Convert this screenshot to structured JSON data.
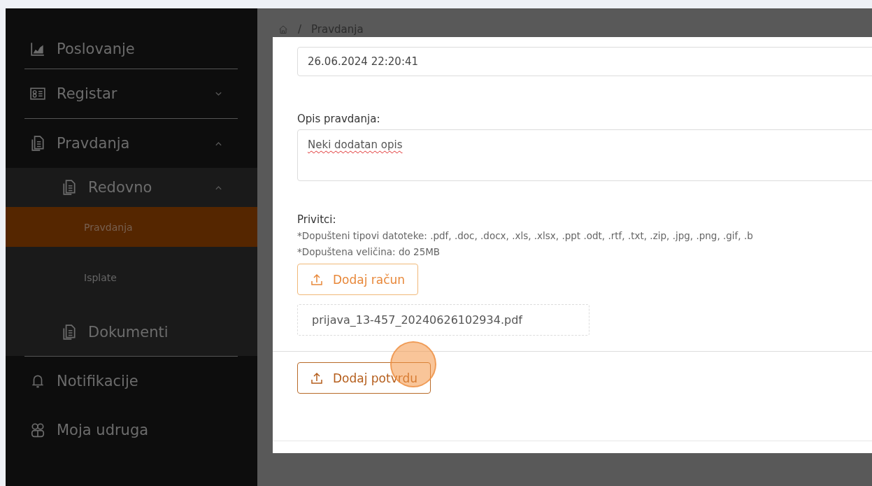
{
  "sidebar": {
    "items": [
      {
        "label": "Poslovanje",
        "kind": "chart"
      },
      {
        "label": "Registar",
        "kind": "card",
        "expanded": false
      },
      {
        "label": "Pravdanja",
        "kind": "docs",
        "expanded": true,
        "children": [
          {
            "label": "Redovno",
            "kind": "docs",
            "expanded": true,
            "children": [
              {
                "label": "Pravdanja",
                "selected": true
              },
              {
                "label": "Isplate",
                "selected": false
              }
            ]
          },
          {
            "label": "Dokumenti",
            "kind": "docs"
          }
        ]
      },
      {
        "label": "Notifikacije",
        "kind": "bell"
      },
      {
        "label": "Moja udruga",
        "kind": "group"
      }
    ]
  },
  "breadcrumb": {
    "items": [
      "/",
      "Pravdanja"
    ]
  },
  "form": {
    "date_value": "26.06.2024 22:20:41",
    "description_label": "Opis pravdanja:",
    "description_value": "Neki dodatan opis",
    "attachments_label": "Privitci:",
    "hints": [
      "*Dopušteni tipovi datoteke: .pdf, .doc, .docx, .xls, .xlsx, .ppt .odt, .rtf, .txt, .zip, .jpg, .png, .gif, .b",
      "*Dopuštena veličina: do 25MB"
    ],
    "invoice_button": "Dodaj račun",
    "files": [
      "prijava_13-457_20240626102934.pdf"
    ],
    "confirm_button": "Dodaj potvrdu"
  }
}
